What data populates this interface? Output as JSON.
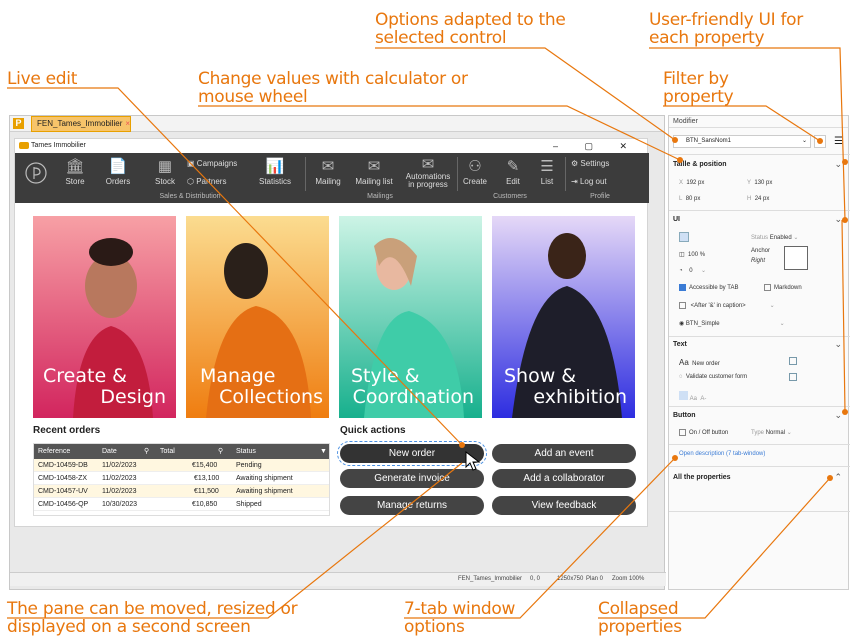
{
  "annotations": {
    "options_adapted": "Options adapted to the",
    "options_adapted_2": "selected control",
    "user_friendly": "User-friendly UI for",
    "user_friendly_2": "each property",
    "live_edit": "Live edit",
    "change_values": "Change values with calculator or",
    "change_values_2": "mouse wheel",
    "filter_by": "Filter by",
    "filter_by_2": "property",
    "pane": "The pane can be moved, resized or",
    "pane_2": "displayed on a second screen",
    "seven_tab": "7-tab window",
    "seven_tab_2": "options",
    "collapsed": "Collapsed",
    "collapsed_2": "properties"
  },
  "editor": {
    "logo": "P",
    "tab_label": "FEN_Tames_Immobilier",
    "tab_close": "×"
  },
  "window": {
    "title": "Tames Immobilier",
    "controls": "– ▢ ✕"
  },
  "ribbon": {
    "store": "Store",
    "orders": "Orders",
    "stock": "Stock",
    "campaigns": "Campaigns",
    "partners": "Partners",
    "statistics": "Statistics",
    "mailing": "Mailing",
    "mailing_list": "Mailing list",
    "automations": "Automations",
    "automations_2": "in progress",
    "create": "Create",
    "edit": "Edit",
    "list": "List",
    "settings": "Settings",
    "logout": "Log out",
    "group_sales": "Sales & Distribution",
    "group_mailings": "Mailings",
    "group_customers": "Customers",
    "group_profile": "Profile"
  },
  "cards": [
    {
      "line1": "Create &",
      "line2": "Design",
      "c1": "#f36f6f",
      "c2": "#d2255e"
    },
    {
      "line1": "Manage",
      "line2": "Collections",
      "c1": "#f9c253",
      "c2": "#ef7d10"
    },
    {
      "line1": "Style &",
      "line2": "Coordination",
      "c1": "#7be4c6",
      "c2": "#17b08d"
    },
    {
      "line1": "Show &",
      "line2": "exhibition",
      "c1": "#8b8bf2",
      "c2": "#2d2de0"
    }
  ],
  "recent_orders": {
    "title": "Recent orders",
    "headers": {
      "reference": "Reference",
      "date": "Date",
      "total": "Total",
      "status": "Status"
    },
    "rows": [
      {
        "reference": "CMD-10459-DB",
        "date": "11/02/2023",
        "total": "€15,400",
        "status": "Pending"
      },
      {
        "reference": "CMD-10458-ZX",
        "date": "11/02/2023",
        "total": "€13,100",
        "status": "Awaiting shipment"
      },
      {
        "reference": "CMD-10457-UV",
        "date": "11/02/2023",
        "total": "€11,500",
        "status": "Awaiting shipment"
      },
      {
        "reference": "CMD-10456-QP",
        "date": "10/30/2023",
        "total": "€10,850",
        "status": "Shipped"
      }
    ]
  },
  "quick_actions": {
    "title": "Quick actions",
    "new_order": "New order",
    "generate_invoice": "Generate invoice",
    "manage_returns": "Manage returns",
    "add_event": "Add an event",
    "add_collaborator": "Add a collaborator",
    "view_feedback": "View feedback"
  },
  "statusbar": {
    "window": "FEN_Tames_Immobilier",
    "coords": "0, 0",
    "size": "1250x750",
    "plan": "Plan 0",
    "zoom": "Zoom 100%"
  },
  "modifier": {
    "title": "Modifier",
    "selected_control": "BTN_SansNom1",
    "size_position": "Taille & position",
    "x_label": "X",
    "x_val": "192 px",
    "y_label": "Y",
    "y_val": "130 px",
    "l_label": "L",
    "l_val": "80 px",
    "h_label": "H",
    "h_val": "24 px",
    "ui": "UI",
    "status_label": "Status",
    "status_val": "Enabled",
    "opacity": "100 %",
    "anchor_label": "Anchor",
    "anchor_val": "Right",
    "angle": "0",
    "accessible_tab": "Accessible by TAB",
    "markdown": "Markdown",
    "after_caption": "<After '&' in caption>",
    "style": "BTN_Simple",
    "text": "Text",
    "caption": "New order",
    "tooltip": "Validate customer form",
    "aa": "Aa",
    "button": "Button",
    "on_off": "On / Off button",
    "type_label": "Type",
    "type_val": "Normal",
    "open_description": "Open description (7 tab-window)",
    "all_properties": "All the properties"
  },
  "colors": {
    "accent": "#e8770e",
    "ribbon": "#3c3c3c",
    "button": "#444444",
    "selection": "#3a7bd5"
  }
}
